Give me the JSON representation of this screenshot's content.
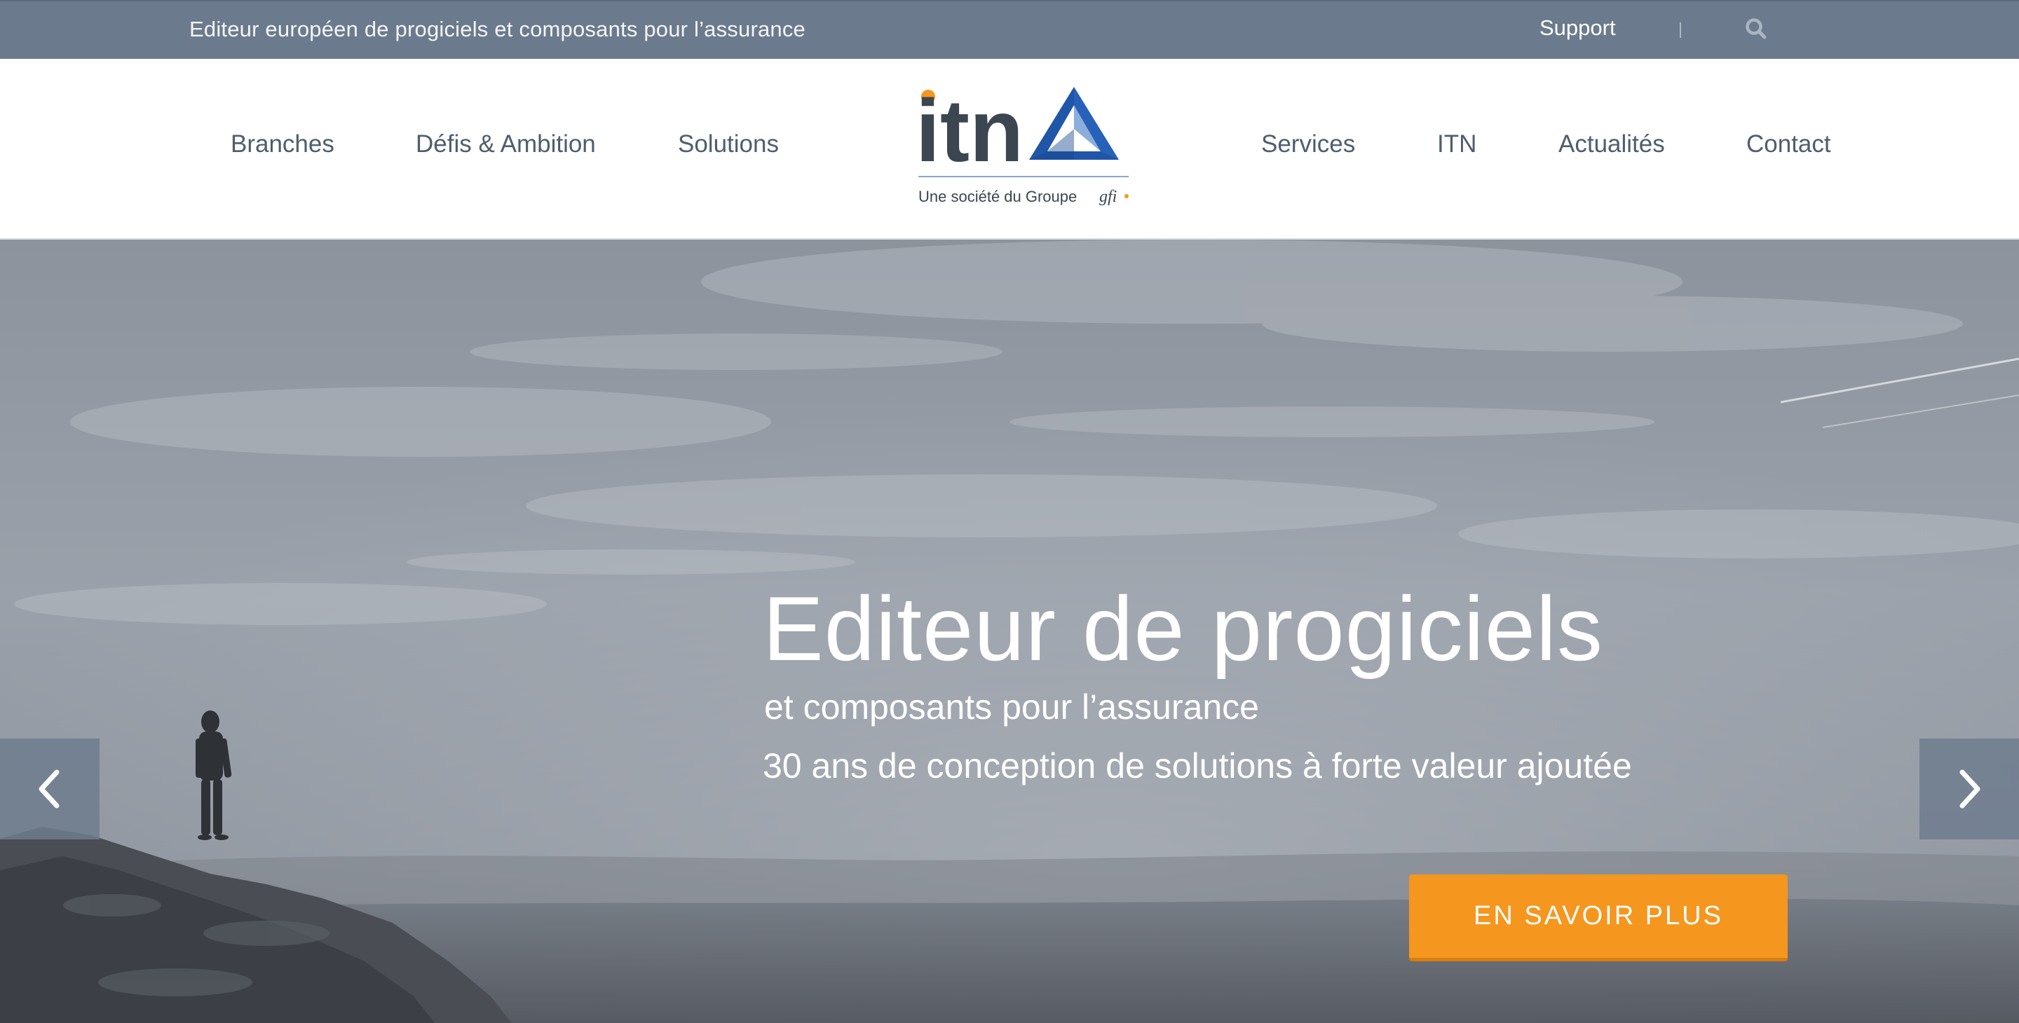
{
  "topbar": {
    "tagline": "Editeur européen de progiciels et composants pour l’assurance",
    "support_label": "Support",
    "search_icon": "search-icon",
    "background": "#6b7a8c"
  },
  "nav": {
    "left": [
      "Branches",
      "Défis & Ambition",
      "Solutions"
    ],
    "right": [
      "Services",
      "ITN",
      "Actualités",
      "Contact"
    ]
  },
  "logo": {
    "wordmark": "itn",
    "tagline": "Une société du Groupe",
    "group": "gfi",
    "colors": {
      "text": "#3b4650",
      "dot": "#f5961e",
      "triangle": "#1f56a8"
    }
  },
  "hero": {
    "title": "Editeur de progiciels",
    "subtitle": "et composants pour l’assurance",
    "description": "30 ans de conception de solutions à forte valeur ajoutée",
    "cta_label": "EN SAVOIR PLUS",
    "cta_color": "#f5961e",
    "prev_icon": "chevron-left-icon",
    "next_icon": "chevron-right-icon"
  }
}
